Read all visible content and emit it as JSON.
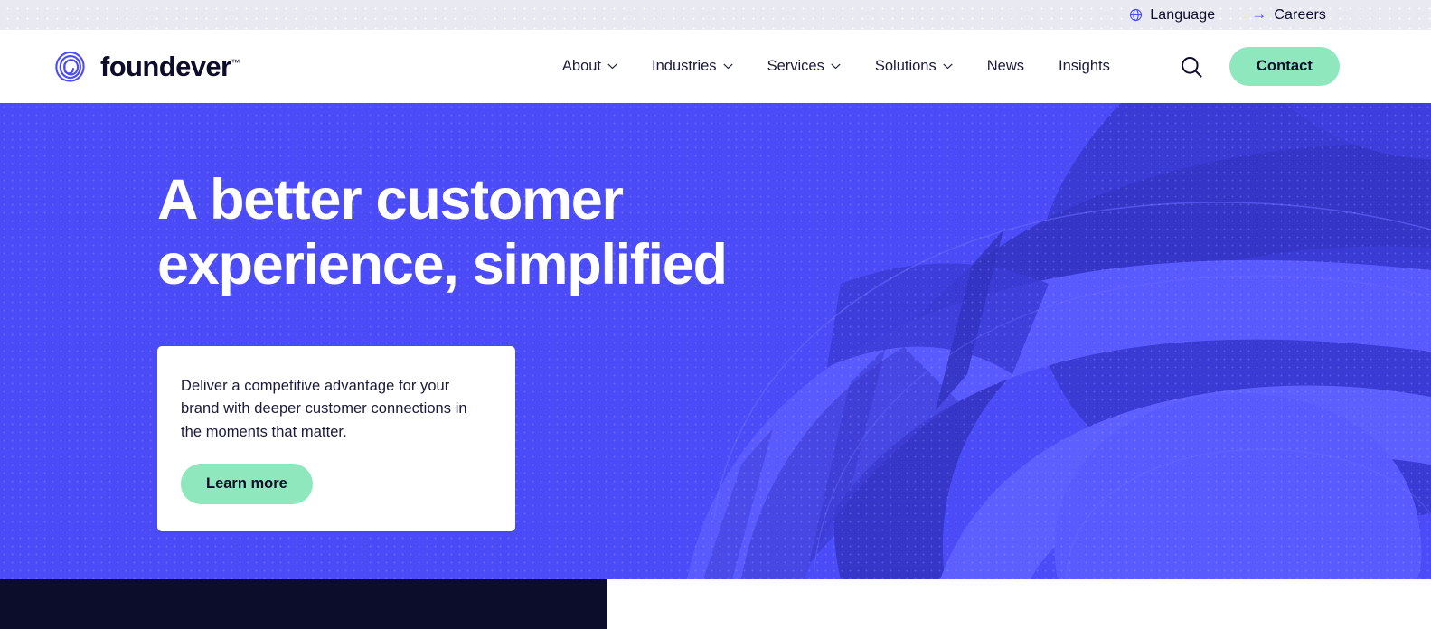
{
  "brand": {
    "name": "foundever",
    "trademark": "™",
    "logo_icon": "foundever-spiral-logo-icon",
    "wordmark_color": "#0d0d2b",
    "mark_color": "#4b4bf7"
  },
  "utility_bar": {
    "background": "#e9e9f1",
    "items": [
      {
        "label": "Language",
        "icon": "globe-icon"
      },
      {
        "label": "Careers",
        "icon": "arrow-right-icon"
      }
    ]
  },
  "nav": {
    "items": [
      {
        "label": "About",
        "has_dropdown": true
      },
      {
        "label": "Industries",
        "has_dropdown": true
      },
      {
        "label": "Services",
        "has_dropdown": true
      },
      {
        "label": "Solutions",
        "has_dropdown": true
      },
      {
        "label": "News",
        "has_dropdown": false
      },
      {
        "label": "Insights",
        "has_dropdown": false
      }
    ],
    "search_icon": "search-icon",
    "contact_label": "Contact",
    "contact_color": "#8fe8bd"
  },
  "hero": {
    "background_color": "#4b4bf7",
    "title_line1": "A better customer",
    "title_line2": "experience, simplified",
    "card": {
      "body": "Deliver a competitive advantage for your brand with deeper customer connections in the moments that matter.",
      "cta_label": "Learn more",
      "cta_color": "#8fe8bd"
    }
  },
  "below_fold": {
    "dark_block_color": "#0c0c2b",
    "light_block_color": "#ffffff"
  }
}
